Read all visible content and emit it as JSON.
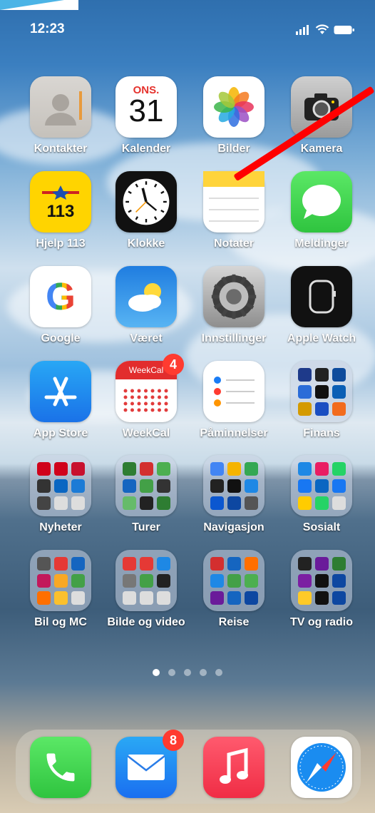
{
  "status": {
    "time": "12:23"
  },
  "apps": [
    {
      "name": "app-kontakter",
      "label": "Kontakter"
    },
    {
      "name": "app-kalender",
      "label": "Kalender",
      "day": "ONS.",
      "date": "31"
    },
    {
      "name": "app-bilder",
      "label": "Bilder"
    },
    {
      "name": "app-kamera",
      "label": "Kamera"
    },
    {
      "name": "app-hjelp113",
      "label": "Hjelp 113",
      "text": "113"
    },
    {
      "name": "app-klokke",
      "label": "Klokke"
    },
    {
      "name": "app-notater",
      "label": "Notater"
    },
    {
      "name": "app-meldinger",
      "label": "Meldinger"
    },
    {
      "name": "app-google",
      "label": "Google",
      "text": "G"
    },
    {
      "name": "app-vaeret",
      "label": "Været"
    },
    {
      "name": "app-innstillinger",
      "label": "Innstillinger"
    },
    {
      "name": "app-apple-watch",
      "label": "Apple Watch"
    },
    {
      "name": "app-app-store",
      "label": "App Store"
    },
    {
      "name": "app-weekcal",
      "label": "WeekCal",
      "badge": "4",
      "text": "WeekCal"
    },
    {
      "name": "app-paminnelser",
      "label": "Påminnelser"
    },
    {
      "name": "folder-finans",
      "label": "Finans"
    },
    {
      "name": "folder-nyheter",
      "label": "Nyheter"
    },
    {
      "name": "folder-turer",
      "label": "Turer"
    },
    {
      "name": "folder-navigasjon",
      "label": "Navigasjon"
    },
    {
      "name": "folder-sosialt",
      "label": "Sosialt"
    },
    {
      "name": "folder-bil-og-mc",
      "label": "Bil og MC"
    },
    {
      "name": "folder-bilde-og-video",
      "label": "Bilde og video"
    },
    {
      "name": "folder-reise",
      "label": "Reise"
    },
    {
      "name": "folder-tv-og-radio",
      "label": "TV og radio"
    }
  ],
  "dock": [
    {
      "name": "dock-telefon"
    },
    {
      "name": "dock-mail",
      "badge": "8"
    },
    {
      "name": "dock-musikk"
    },
    {
      "name": "dock-safari"
    }
  ],
  "page_indicator": {
    "pages": 5,
    "current": 1
  },
  "colors": {
    "badge": "#ff3b30",
    "annotation_line": "#ff0000"
  }
}
